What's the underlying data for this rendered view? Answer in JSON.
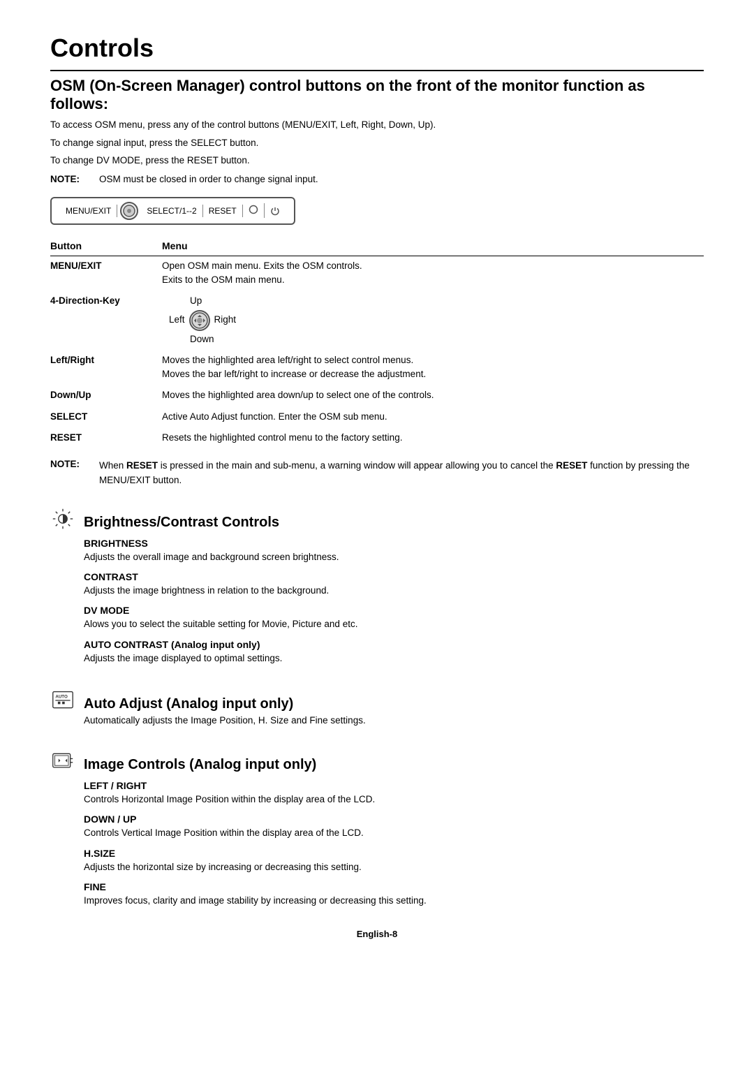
{
  "page": {
    "title": "Controls",
    "footer": "English-8"
  },
  "osm_section": {
    "heading": "OSM (On-Screen Manager) control buttons on the front of the monitor function as follows:",
    "intro_lines": [
      "To access OSM menu, press any of the control buttons (MENU/EXIT, Left, Right, Down, Up).",
      "To change signal input, press the SELECT button.",
      "To change DV MODE, press the RESET button."
    ],
    "note_label": "NOTE:",
    "note_text": "OSM must be closed in order to change signal input.",
    "control_bar": {
      "menu_exit": "MENU/EXIT",
      "select": "SELECT/1--2",
      "reset": "RESET"
    },
    "button_table": {
      "col1_header": "Button",
      "col2_header": "Menu",
      "rows": [
        {
          "button": "MENU/EXIT",
          "menu": "Open OSM main menu. Exits the OSM controls.\nExits to the OSM main menu."
        },
        {
          "button": "4-Direction-Key",
          "menu": "direction_key_special"
        },
        {
          "button": "Left/Right",
          "menu": "Moves the highlighted area left/right to select control menus.\nMoves the bar left/right to increase or decrease the adjustment."
        },
        {
          "button": "Down/Up",
          "menu": "Moves the highlighted area down/up to select one of the controls."
        },
        {
          "button": "SELECT",
          "menu": "Active Auto Adjust function. Enter the OSM sub menu."
        },
        {
          "button": "RESET",
          "menu": "Resets the highlighted control menu to the factory setting."
        }
      ]
    },
    "note2_label": "NOTE:",
    "note2_text": "When RESET is pressed in the main and sub-menu, a warning window will appear allowing you to cancel the RESET function by pressing the MENU/EXIT button."
  },
  "brightness_section": {
    "heading": "Brightness/Contrast Controls",
    "subsections": [
      {
        "title": "BRIGHTNESS",
        "text": "Adjusts the overall image and background screen brightness."
      },
      {
        "title": "CONTRAST",
        "text": "Adjusts the image brightness in relation to the background."
      },
      {
        "title": "DV MODE",
        "text": "Alows you to select the suitable setting for Movie, Picture and etc."
      },
      {
        "title": "AUTO CONTRAST (Analog input only)",
        "text": "Adjusts the image displayed to optimal settings."
      }
    ]
  },
  "auto_adjust_section": {
    "heading": "Auto Adjust (Analog input only)",
    "text": "Automatically adjusts the Image Position, H. Size and Fine settings."
  },
  "image_controls_section": {
    "heading": "Image Controls (Analog input only)",
    "subsections": [
      {
        "title": "LEFT / RIGHT",
        "text": "Controls Horizontal Image Position within the display area of the LCD."
      },
      {
        "title": "DOWN / UP",
        "text": "Controls Vertical Image Position within the display area of the LCD."
      },
      {
        "title": "H.SIZE",
        "text": "Adjusts the horizontal size by increasing or decreasing this setting."
      },
      {
        "title": "FINE",
        "text": "Improves focus, clarity and image stability by increasing or decreasing this setting."
      }
    ]
  },
  "direction_key": {
    "up": "Up",
    "left": "Left",
    "right": "Right",
    "down": "Down"
  }
}
